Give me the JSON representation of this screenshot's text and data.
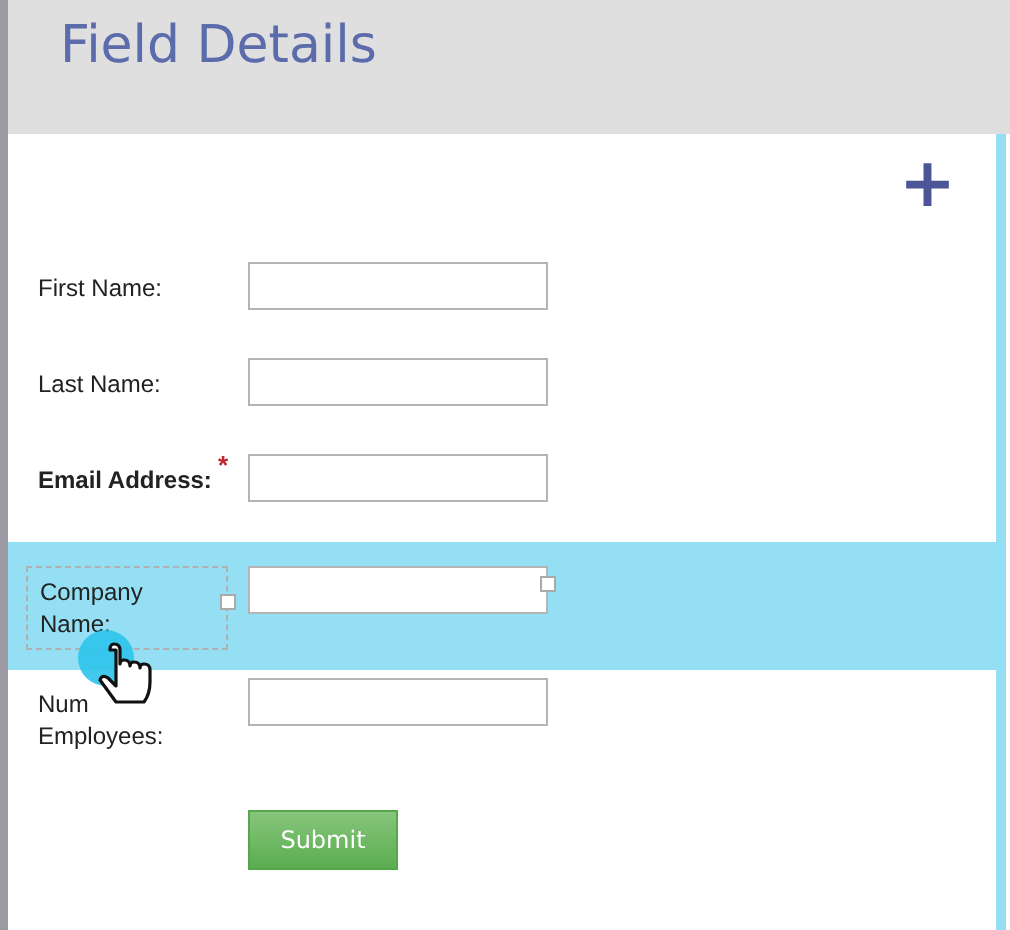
{
  "header": {
    "title": "Field Details"
  },
  "add_button": {
    "label": "+"
  },
  "fields": [
    {
      "label": "First Name:",
      "required": false,
      "selected": false
    },
    {
      "label": "Last Name:",
      "required": false,
      "selected": false
    },
    {
      "label": "Email Address:",
      "required": true,
      "required_mark": "*",
      "selected": false
    },
    {
      "label": "Company Name:",
      "required": false,
      "selected": true
    },
    {
      "label": "Num Employees:",
      "required": false,
      "selected": false
    }
  ],
  "submit_button": {
    "label": "Submit"
  }
}
